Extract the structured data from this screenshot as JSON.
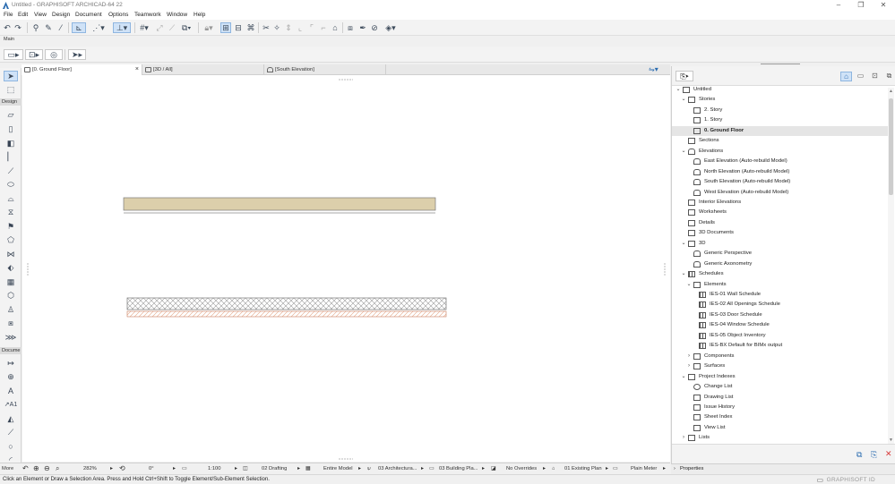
{
  "window": {
    "title": "Untitled - GRAPHISOFT ARCHICAD-64 22"
  },
  "menu": [
    "File",
    "Edit",
    "View",
    "Design",
    "Document",
    "Options",
    "Teamwork",
    "Window",
    "Help"
  ],
  "toolbar": {
    "main_label": "Main"
  },
  "toolbox": {
    "design_label": "Design",
    "document_label": "Docume",
    "more_label": "More"
  },
  "tabs": [
    {
      "label": "[0. Ground Floor]",
      "active": true
    },
    {
      "label": "[3D / All]",
      "active": false
    },
    {
      "label": "[South Elevation]",
      "active": false
    }
  ],
  "statusbar": {
    "zoom": "282%",
    "angle": "0°",
    "scale": "1:100",
    "layer_combo": "02 Drafting",
    "view_filter": "Entire Model",
    "model_view": "03 Architectura...",
    "plan_set": "03 Building Pla...",
    "overrides": "No Overrides",
    "renovation": "01 Existing Plan",
    "dimension": "Plain Meter"
  },
  "hint": "Click an Element or Draw a Selection Area. Press and Hold Ctrl+Shift to Toggle Element/Sub-Element Selection.",
  "brand": "GRAPHISOFT ID",
  "navigator": {
    "tree": [
      {
        "label": "Untitled",
        "level": 0,
        "chev": "v",
        "icon": "project-icon"
      },
      {
        "label": "Stories",
        "level": 1,
        "chev": "v",
        "icon": "folder-icon"
      },
      {
        "label": "2. Story",
        "level": 2,
        "chev": "",
        "icon": "story-icon"
      },
      {
        "label": "1. Story",
        "level": 2,
        "chev": "",
        "icon": "story-icon"
      },
      {
        "label": "0. Ground Floor",
        "level": 2,
        "chev": "",
        "icon": "story-icon",
        "selected": true
      },
      {
        "label": "Sections",
        "level": 1,
        "chev": "",
        "icon": "section-icon"
      },
      {
        "label": "Elevations",
        "level": 1,
        "chev": "v",
        "icon": "elevation-icon"
      },
      {
        "label": "East Elevation (Auto-rebuild Model)",
        "level": 2,
        "chev": "",
        "icon": "elevation-icon"
      },
      {
        "label": "North Elevation (Auto-rebuild Model)",
        "level": 2,
        "chev": "",
        "icon": "elevation-icon"
      },
      {
        "label": "South Elevation (Auto-rebuild Model)",
        "level": 2,
        "chev": "",
        "icon": "elevation-icon"
      },
      {
        "label": "West Elevation (Auto-rebuild Model)",
        "level": 2,
        "chev": "",
        "icon": "elevation-icon"
      },
      {
        "label": "Interior Elevations",
        "level": 1,
        "chev": "",
        "icon": "interior-elevation-icon"
      },
      {
        "label": "Worksheets",
        "level": 1,
        "chev": "",
        "icon": "worksheet-icon"
      },
      {
        "label": "Details",
        "level": 1,
        "chev": "",
        "icon": "detail-icon"
      },
      {
        "label": "3D Documents",
        "level": 1,
        "chev": "",
        "icon": "3d-document-icon"
      },
      {
        "label": "3D",
        "level": 1,
        "chev": "v",
        "icon": "3d-icon"
      },
      {
        "label": "Generic Perspective",
        "level": 2,
        "chev": "",
        "icon": "perspective-icon"
      },
      {
        "label": "Generic Axonometry",
        "level": 2,
        "chev": "",
        "icon": "axonometry-icon"
      },
      {
        "label": "Schedules",
        "level": 1,
        "chev": "v",
        "icon": "schedule-icon"
      },
      {
        "label": "Elements",
        "level": 2,
        "chev": "v",
        "icon": "elements-icon"
      },
      {
        "label": "IES-01 Wall Schedule",
        "level": 3,
        "chev": "",
        "icon": "schedule-icon"
      },
      {
        "label": "IES-02 All Openings Schedule",
        "level": 3,
        "chev": "",
        "icon": "schedule-icon"
      },
      {
        "label": "IES-03 Door Schedule",
        "level": 3,
        "chev": "",
        "icon": "schedule-icon"
      },
      {
        "label": "IES-04 Window Schedule",
        "level": 3,
        "chev": "",
        "icon": "schedule-icon"
      },
      {
        "label": "IES-05 Object Inventory",
        "level": 3,
        "chev": "",
        "icon": "schedule-icon"
      },
      {
        "label": "IES-BX Default for BIMx output",
        "level": 3,
        "chev": "",
        "icon": "schedule-icon"
      },
      {
        "label": "Components",
        "level": 2,
        "chev": ">",
        "icon": "components-icon"
      },
      {
        "label": "Surfaces",
        "level": 2,
        "chev": ">",
        "icon": "surfaces-icon"
      },
      {
        "label": "Project Indexes",
        "level": 1,
        "chev": "v",
        "icon": "index-icon"
      },
      {
        "label": "Change List",
        "level": 2,
        "chev": "",
        "icon": "change-list-icon"
      },
      {
        "label": "Drawing List",
        "level": 2,
        "chev": "",
        "icon": "drawing-list-icon"
      },
      {
        "label": "Issue History",
        "level": 2,
        "chev": "",
        "icon": "issue-history-icon"
      },
      {
        "label": "Sheet Index",
        "level": 2,
        "chev": "",
        "icon": "sheet-index-icon"
      },
      {
        "label": "View List",
        "level": 2,
        "chev": "",
        "icon": "view-list-icon"
      },
      {
        "label": "Lists",
        "level": 1,
        "chev": ">",
        "icon": "lists-icon"
      }
    ]
  },
  "properties": {
    "label": "Properties"
  },
  "colors": {
    "slab_fill": "#dccfab",
    "selection": "#cfe2f7",
    "accent": "#2b6cb0",
    "close_red": "#d83b3b"
  }
}
